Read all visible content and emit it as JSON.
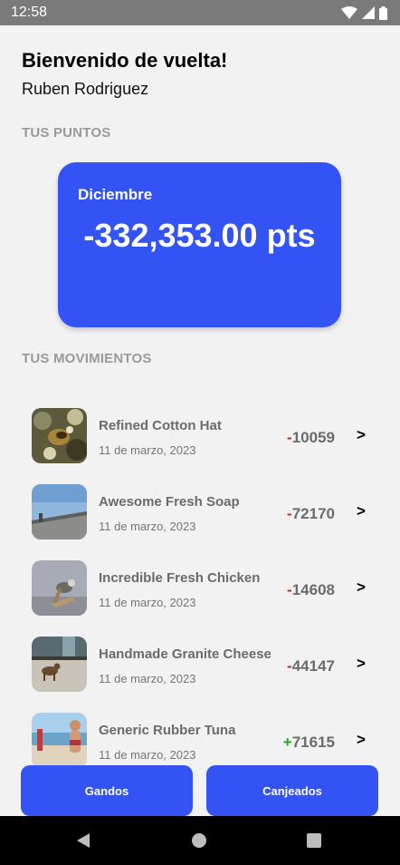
{
  "status_bar": {
    "time": "12:58"
  },
  "header": {
    "welcome": "Bienvenido de vuelta!",
    "user_name": "Ruben Rodriguez"
  },
  "points": {
    "section_label": "TUS PUNTOS",
    "month": "Diciembre",
    "total": "-332,353.00 pts"
  },
  "movements": {
    "section_label": "TUS MOVIMIENTOS",
    "items": [
      {
        "title": "Refined Cotton Hat",
        "date": "11 de marzo, 2023",
        "sign": "-",
        "amount": "10059",
        "thumb": "bee-flower-photo"
      },
      {
        "title": "Awesome Fresh Soap",
        "date": "11 de marzo, 2023",
        "sign": "-",
        "amount": "72170",
        "thumb": "sky-wall-photo"
      },
      {
        "title": "Incredible Fresh Chicken",
        "date": "11 de marzo, 2023",
        "sign": "-",
        "amount": "14608",
        "thumb": "bird-perch-photo"
      },
      {
        "title": "Handmade Granite Cheese",
        "date": "11 de marzo, 2023",
        "sign": "-",
        "amount": "44147",
        "thumb": "dog-street-photo"
      },
      {
        "title": "Generic Rubber Tuna",
        "date": "11 de marzo, 2023",
        "sign": "+",
        "amount": "71615",
        "thumb": "beach-runner-photo"
      }
    ],
    "chevron": ">"
  },
  "buttons": {
    "earned": "Gandos",
    "redeemed": "Canjeados"
  },
  "colors": {
    "primary": "#3353f5",
    "negative": "#e01b1b",
    "positive": "#1aaa2a",
    "background": "#f2f2f2"
  },
  "icons": [
    "wifi-icon",
    "signal-icon",
    "battery-icon",
    "nav-back-icon",
    "nav-home-icon",
    "nav-recent-icon"
  ]
}
